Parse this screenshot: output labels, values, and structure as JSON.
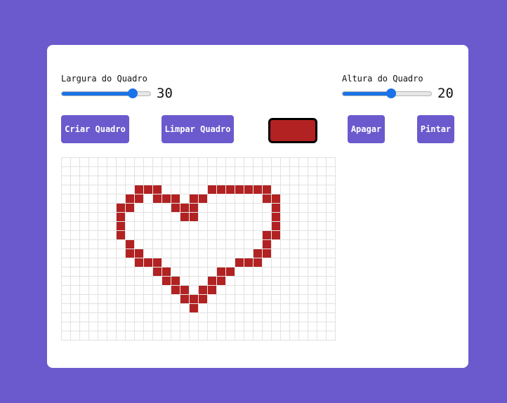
{
  "width_slider": {
    "label": "Largura do Quadro",
    "value": "30",
    "fraction": 0.8
  },
  "height_slider": {
    "label": "Altura do Quadro",
    "value": "20",
    "fraction": 0.55
  },
  "buttons": {
    "create": "Criar Quadro",
    "clear": "Limpar Quadro",
    "erase": "Apagar",
    "paint": "Pintar"
  },
  "colors": {
    "accent": "#6a5acd",
    "paint": "#b22222",
    "slider": "#1a73e8"
  },
  "canvas": {
    "columns": 30,
    "rows": 20,
    "filled_cells": [
      [
        3,
        8
      ],
      [
        3,
        9
      ],
      [
        3,
        10
      ],
      [
        3,
        16
      ],
      [
        3,
        17
      ],
      [
        3,
        18
      ],
      [
        3,
        19
      ],
      [
        3,
        20
      ],
      [
        3,
        21
      ],
      [
        3,
        22
      ],
      [
        4,
        7
      ],
      [
        4,
        8
      ],
      [
        4,
        10
      ],
      [
        4,
        11
      ],
      [
        4,
        12
      ],
      [
        4,
        14
      ],
      [
        4,
        15
      ],
      [
        4,
        22
      ],
      [
        4,
        23
      ],
      [
        5,
        6
      ],
      [
        5,
        7
      ],
      [
        5,
        12
      ],
      [
        5,
        13
      ],
      [
        5,
        14
      ],
      [
        5,
        23
      ],
      [
        6,
        6
      ],
      [
        6,
        13
      ],
      [
        6,
        14
      ],
      [
        6,
        23
      ],
      [
        7,
        6
      ],
      [
        7,
        23
      ],
      [
        8,
        6
      ],
      [
        8,
        22
      ],
      [
        8,
        23
      ],
      [
        9,
        7
      ],
      [
        9,
        22
      ],
      [
        10,
        7
      ],
      [
        10,
        8
      ],
      [
        10,
        21
      ],
      [
        10,
        22
      ],
      [
        11,
        8
      ],
      [
        11,
        9
      ],
      [
        11,
        10
      ],
      [
        11,
        19
      ],
      [
        11,
        20
      ],
      [
        11,
        21
      ],
      [
        12,
        10
      ],
      [
        12,
        11
      ],
      [
        12,
        17
      ],
      [
        12,
        18
      ],
      [
        13,
        11
      ],
      [
        13,
        12
      ],
      [
        13,
        16
      ],
      [
        13,
        17
      ],
      [
        14,
        12
      ],
      [
        14,
        13
      ],
      [
        14,
        15
      ],
      [
        14,
        16
      ],
      [
        15,
        13
      ],
      [
        15,
        14
      ],
      [
        15,
        15
      ],
      [
        16,
        14
      ]
    ]
  }
}
